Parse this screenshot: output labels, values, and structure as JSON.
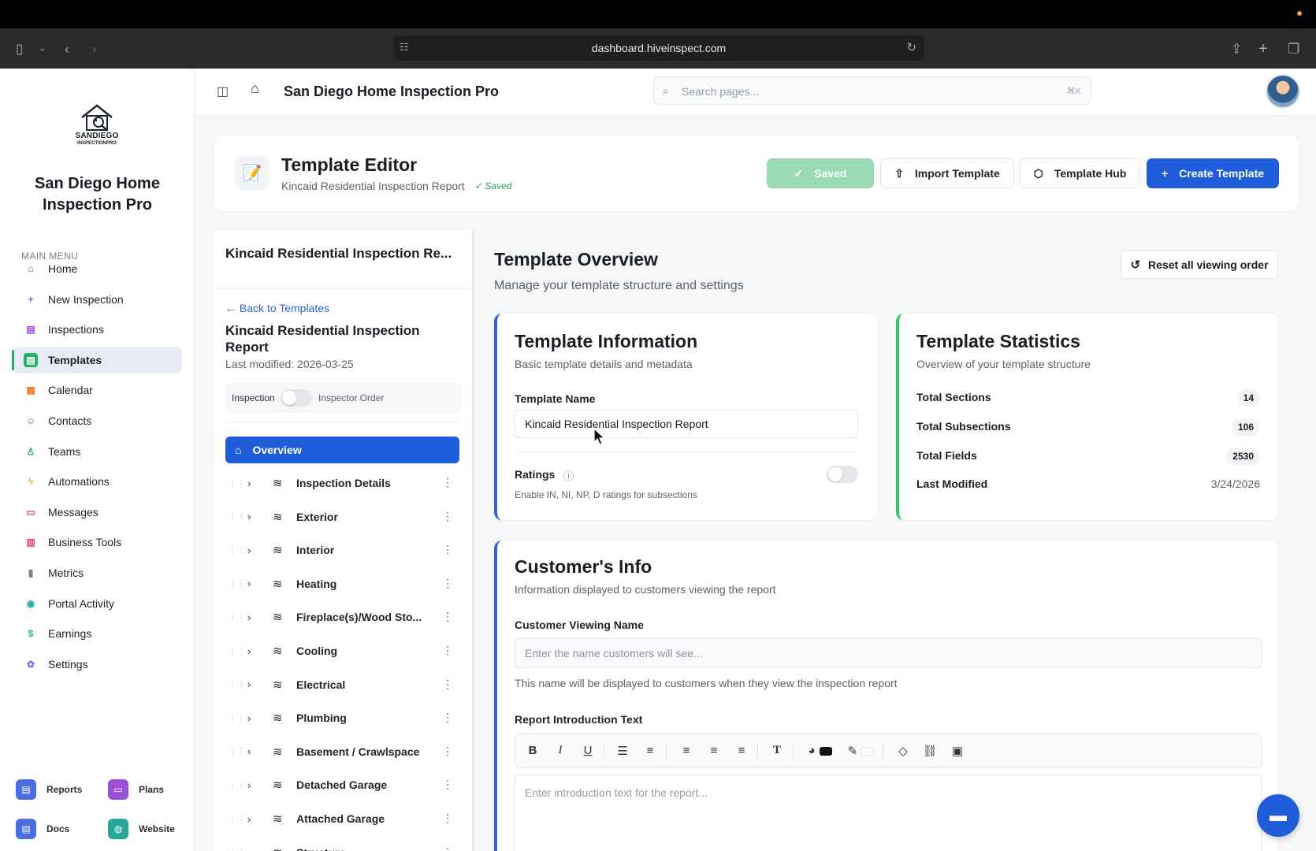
{
  "browser": {
    "url": "dashboard.hiveinspect.com"
  },
  "sidebar": {
    "logo_line1": "SANDIEGO",
    "logo_line2": "INSPECTIONPRO",
    "brand_name": "San Diego Home Inspection Pro",
    "menu_title": "MAIN MENU",
    "items": [
      {
        "label": "Home",
        "icon": "home-icon",
        "color": "#4a6ee0"
      },
      {
        "label": "New Inspection",
        "icon": "plus-icon",
        "color": "#8b5cf6"
      },
      {
        "label": "Inspections",
        "icon": "clipboard-icon",
        "color": "#9b4fd6"
      },
      {
        "label": "Templates",
        "icon": "document-icon",
        "color": "#24b36b"
      },
      {
        "label": "Calendar",
        "icon": "calendar-icon",
        "color": "#ef7a33"
      },
      {
        "label": "Contacts",
        "icon": "users-icon",
        "color": "#6d5ed6"
      },
      {
        "label": "Teams",
        "icon": "user-plus-icon",
        "color": "#2fb57a"
      },
      {
        "label": "Automations",
        "icon": "bolt-icon",
        "color": "#f2b01e"
      },
      {
        "label": "Messages",
        "icon": "message-icon",
        "color": "#e2456b"
      },
      {
        "label": "Business Tools",
        "icon": "briefcase-icon",
        "color": "#e2456b"
      },
      {
        "label": "Metrics",
        "icon": "bar-chart-icon",
        "color": "#7a7f8a"
      },
      {
        "label": "Portal Activity",
        "icon": "eye-icon",
        "color": "#26a99a"
      },
      {
        "label": "Earnings",
        "icon": "dollar-icon",
        "color": "#2fb57a"
      },
      {
        "label": "Settings",
        "icon": "gear-icon",
        "color": "#8b5cf6"
      }
    ],
    "active_index": 3,
    "tiles": [
      {
        "label": "Reports",
        "icon": "document-icon",
        "color": "#4a6ee0"
      },
      {
        "label": "Plans",
        "icon": "card-icon",
        "color": "#9b4fd6"
      },
      {
        "label": "Docs",
        "icon": "document-icon",
        "color": "#4a6ee0"
      },
      {
        "label": "Website",
        "icon": "globe-icon",
        "color": "#26a99a"
      }
    ]
  },
  "header": {
    "title": "San Diego Home Inspection Pro",
    "search_placeholder": "Search pages...",
    "search_shortcut": "⌘K"
  },
  "editor": {
    "title": "Template Editor",
    "subtitle": "Kincaid Residential Inspection Report",
    "saved_mini": "✓ Saved",
    "saved_button": "Saved",
    "import_button": "Import Template",
    "hub_button": "Template Hub",
    "create_button": "Create Template"
  },
  "section_panel": {
    "title": "Kincaid Residential Inspection Re...",
    "back_link": "← Back to Templates",
    "template_name": "Kincaid Residential Inspection Report",
    "last_modified": "Last modified: 2026-03-25",
    "toggle_left": "Inspection",
    "toggle_right": "Inspector Order",
    "overview_label": "Overview",
    "sections": [
      "Inspection Details",
      "Exterior",
      "Interior",
      "Heating",
      "Fireplace(s)/Wood Sto...",
      "Cooling",
      "Electrical",
      "Plumbing",
      "Basement / Crawlspace",
      "Detached Garage",
      "Attached Garage",
      "Structure"
    ]
  },
  "main": {
    "title": "Template Overview",
    "subtitle": "Manage your template structure and settings",
    "reset_button": "Reset all viewing order",
    "info_card": {
      "title": "Template Information",
      "subtitle": "Basic template details and metadata",
      "name_label": "Template Name",
      "name_value": "Kincaid Residential Inspection Report",
      "ratings_label": "Ratings",
      "ratings_help": "Enable IN, NI, NP, D ratings for subsections"
    },
    "stats_card": {
      "title": "Template Statistics",
      "subtitle": "Overview of your template structure",
      "rows": [
        {
          "label": "Total Sections",
          "value": "14"
        },
        {
          "label": "Total Subsections",
          "value": "106"
        },
        {
          "label": "Total Fields",
          "value": "2530"
        },
        {
          "label": "Last Modified",
          "value": "3/24/2026"
        }
      ]
    },
    "customer_card": {
      "title": "Customer's Info",
      "subtitle": "Information displayed to customers viewing the report",
      "viewing_name_label": "Customer Viewing Name",
      "viewing_name_placeholder": "Enter the name customers will see...",
      "viewing_name_help": "This name will be displayed to customers when they view the inspection report",
      "intro_label": "Report Introduction Text",
      "intro_placeholder": "Enter introduction text for the report..."
    }
  }
}
